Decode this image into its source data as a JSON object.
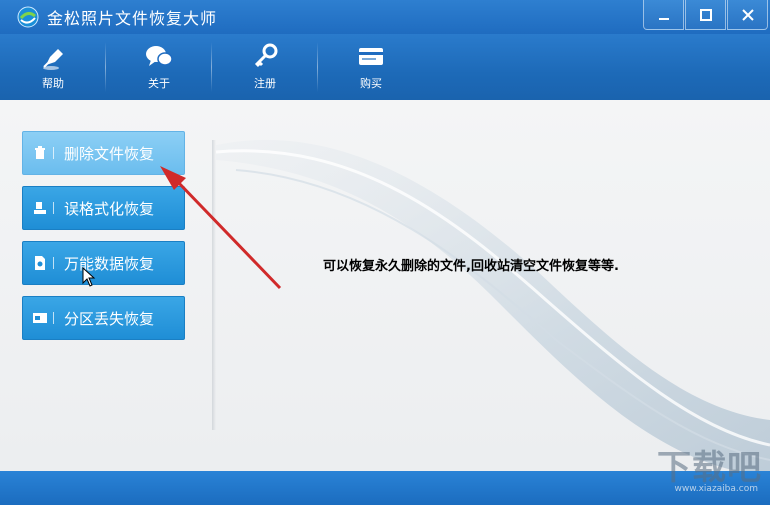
{
  "window": {
    "title": "金松照片文件恢复大师",
    "controls": [
      "minimize",
      "maximize",
      "close"
    ]
  },
  "toolbar": {
    "items": [
      {
        "label": "帮助",
        "icon": "help-pen-icon"
      },
      {
        "label": "关于",
        "icon": "chat-bubble-icon"
      },
      {
        "label": "注册",
        "icon": "key-icon"
      },
      {
        "label": "购买",
        "icon": "card-icon"
      }
    ]
  },
  "functions": {
    "items": [
      {
        "label": "删除文件恢复",
        "icon": "trash-icon",
        "active": true
      },
      {
        "label": "误格式化恢复",
        "icon": "format-icon",
        "active": false
      },
      {
        "label": "万能数据恢复",
        "icon": "file-icon",
        "active": false
      },
      {
        "label": "分区丢失恢复",
        "icon": "partition-icon",
        "active": false
      }
    ]
  },
  "main": {
    "hint": "可以恢复永久删除的文件,回收站清空文件恢复等等."
  },
  "watermark": {
    "brand": "下载吧",
    "url": "www.xiazaiba.com"
  },
  "colors": {
    "titlebar": "#2e7fd0",
    "button": "#1f8ed6",
    "button_active": "#6bbdee",
    "arrow": "#d02a2a"
  }
}
